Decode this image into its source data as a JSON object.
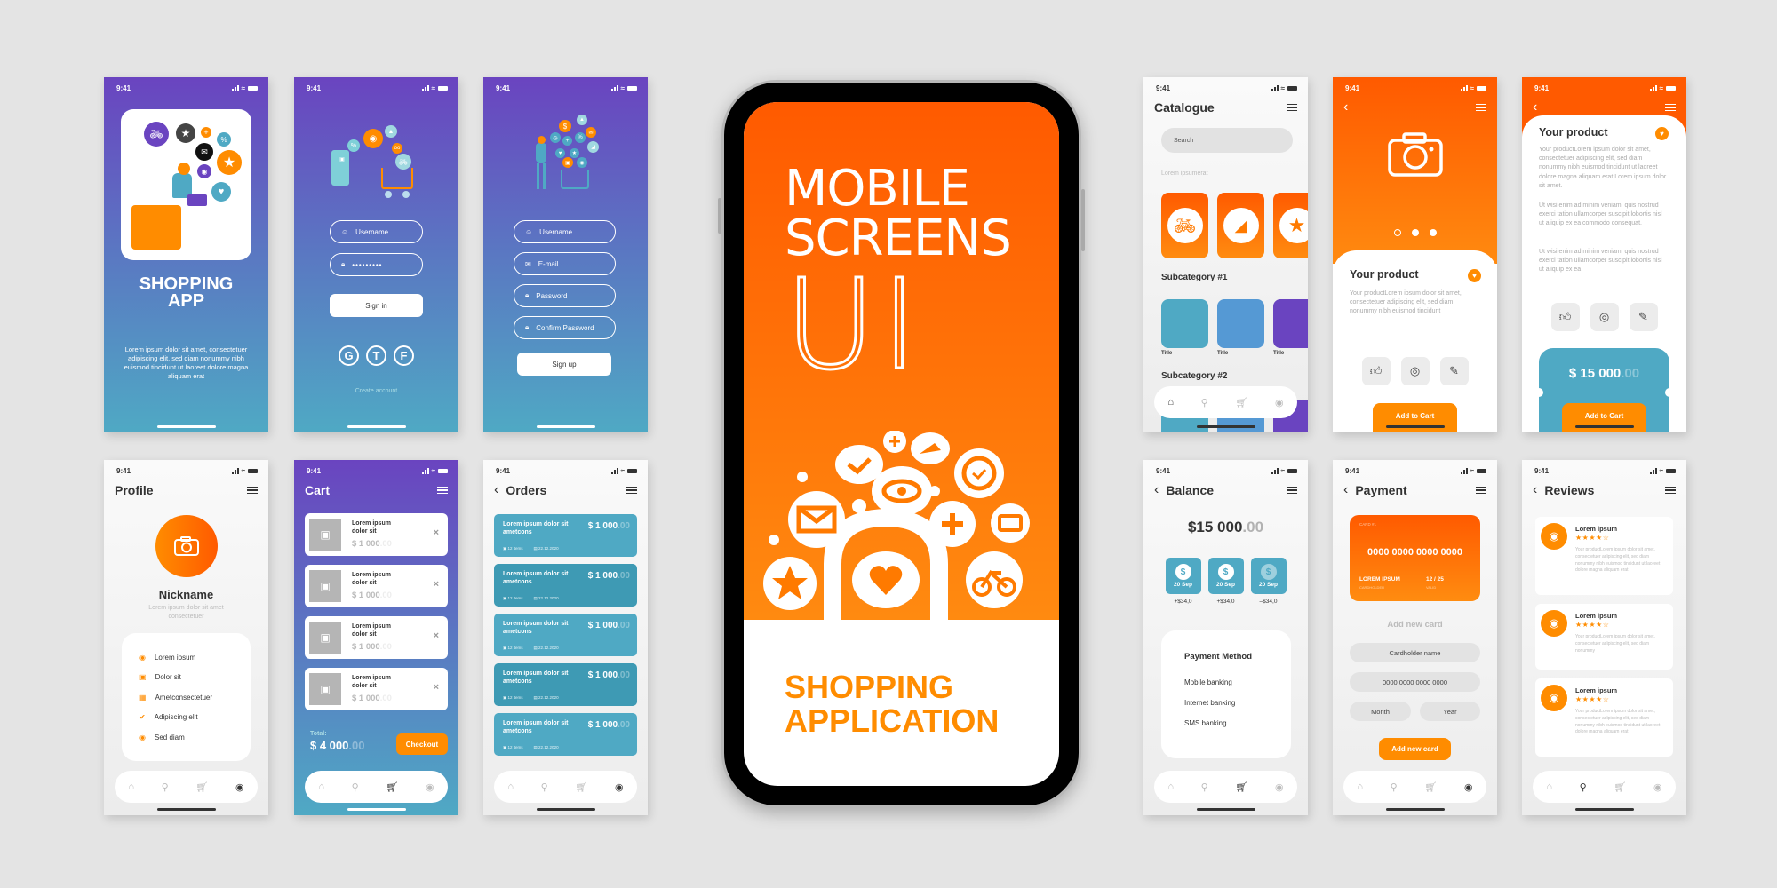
{
  "status_bar": {
    "time": "9:41"
  },
  "nav_icons": [
    "home-icon",
    "search-icon",
    "cart-icon",
    "profile-icon"
  ],
  "colors": {
    "orange": "#ff8c00",
    "deep_orange": "#ff5a00",
    "purple": "#6a44c0",
    "teal": "#4fa9c4",
    "dark_text": "#333333"
  },
  "splash": {
    "title_line1": "SHOPPING",
    "title_line2": "APP",
    "body": "Lorem ipsum dolor sit amet, consectetuer adipiscing elit, sed diam nonummy nibh euismod tincidunt ut laoreet dolore magna aliquam erat"
  },
  "signin": {
    "username_placeholder": "Username",
    "password_value": "•••••••••",
    "signin_label": "Sign in",
    "social": [
      "G",
      "T",
      "F"
    ],
    "create_account": "Create account"
  },
  "signup": {
    "fields": [
      "Username",
      "E-mail",
      "Password",
      "Confirm Password"
    ],
    "signup_label": "Sign up"
  },
  "hero": {
    "line1": "MOBILE",
    "line2": "SCREENS",
    "line3": "UI",
    "sub1": "SHOPPING",
    "sub2": "APPLICATION"
  },
  "catalogue": {
    "title": "Catalogue",
    "search_placeholder": "Search",
    "caption": "Lorem ipsumerat",
    "categories": [
      "bicycle-icon",
      "shoe-icon",
      "star-icon"
    ],
    "sub1_title": "Subcategory #1",
    "sub1_items": [
      {
        "title": "Title",
        "color": "#4fa9c4"
      },
      {
        "title": "Title",
        "color": "#5599d4"
      },
      {
        "title": "Title",
        "color": "#6a44c0"
      }
    ],
    "sub2_title": "Subcategory #2"
  },
  "product1": {
    "title": "Your product",
    "body": "Your productLorem ipsum dolor sit amet, consectetuer adipiscing elit, sed diam nonummy nibh euismod tincidunt",
    "carousel_active": 1,
    "carousel_count": 3,
    "add_to_cart": "Add to Cart"
  },
  "product2": {
    "title": "Your product",
    "para1": "Your productLorem ipsum dolor sit amet, consectetuer adipiscing elit, sed diam nonummy nibh euismod tincidunt ut laoreet dolore magna aliquam erat Lorem ipsum dolor sit amet.",
    "para2": "Ut wisi enim ad minim veniam, quis nostrud exerci tation ullamcorper suscipit lobortis nisl ut aliquip ex ea commodo consequat.",
    "para3": "Ut wisi enim ad minim veniam, quis nostrud exerci tation ullamcorper suscipit lobortis nisl ut aliquip ex ea",
    "price": "$ 15 000",
    "price_cents": ".00",
    "add_to_cart": "Add to Cart"
  },
  "profile": {
    "title": "Profile",
    "nickname": "Nickname",
    "subtitle": "Lorem ipsum dolor sit amet consectetuer",
    "menu": [
      {
        "label": "Lorem ipsum",
        "icon": "user-circle-icon"
      },
      {
        "label": "Dolor sit",
        "icon": "bookmark-icon"
      },
      {
        "label": "Ametconsectetuer",
        "icon": "gift-icon"
      },
      {
        "label": "Adipiscing elit",
        "icon": "shield-check-icon"
      },
      {
        "label": "Sed diam",
        "icon": "lock-circle-icon"
      }
    ]
  },
  "cart": {
    "title": "Cart",
    "items": [
      {
        "name": "Lorem ipsum dolor sit",
        "price": "$ 1 000",
        "cents": ".00"
      },
      {
        "name": "Lorem ipsum dolor sit",
        "price": "$ 1 000",
        "cents": ".00"
      },
      {
        "name": "Lorem ipsum dolor sit",
        "price": "$ 1 000",
        "cents": ".00"
      },
      {
        "name": "Lorem ipsum dolor sit",
        "price": "$ 1 000",
        "cents": ".00"
      }
    ],
    "total_label": "Total:",
    "total": "$ 4 000",
    "total_cents": ".00",
    "checkout": "Checkout"
  },
  "orders": {
    "title": "Orders",
    "items": [
      {
        "name": "Lorem ipsum dolor sit ametcons",
        "price": "$ 1 000",
        "cents": ".00",
        "count": "12 items",
        "date": "22.12.2020"
      },
      {
        "name": "Lorem ipsum dolor sit ametcons",
        "price": "$ 1 000",
        "cents": ".00",
        "count": "12 items",
        "date": "22.12.2020"
      },
      {
        "name": "Lorem ipsum dolor sit ametcons",
        "price": "$ 1 000",
        "cents": ".00",
        "count": "12 items",
        "date": "22.12.2020"
      },
      {
        "name": "Lorem ipsum dolor sit ametcons",
        "price": "$ 1 000",
        "cents": ".00",
        "count": "12 items",
        "date": "22.12.2020"
      },
      {
        "name": "Lorem ipsum dolor sit ametcons",
        "price": "$ 1 000",
        "cents": ".00",
        "count": "12 items",
        "date": "22.12.2020"
      }
    ]
  },
  "balance": {
    "title": "Balance",
    "amount": "$15 000",
    "cents": ".00",
    "transactions": [
      {
        "date": "20 Sep",
        "amount": "+$34,0"
      },
      {
        "date": "20 Sep",
        "amount": "+$34,0"
      },
      {
        "date": "20 Sep",
        "amount": "–$34,0"
      }
    ],
    "method_title": "Payment Method",
    "methods": [
      "Mobile banking",
      "Internet banking",
      "SMS banking"
    ]
  },
  "payment": {
    "title": "Payment",
    "card_label": "CARD #1",
    "card_number": "0000 0000 0000 0000",
    "holder": "LOREM IPSUM",
    "holder_label": "CARDHOLDER",
    "valid": "12 / 25",
    "valid_label": "VALID",
    "add_title": "Add new card",
    "name_placeholder": "Cardholder name",
    "number_placeholder": "0000 0000 0000 0000",
    "month_placeholder": "Month",
    "year_placeholder": "Year",
    "add_button": "Add new card"
  },
  "reviews": {
    "title": "Reviews",
    "items": [
      {
        "name": "Lorem ipsum",
        "rating": 4,
        "text": "Your productLorem ipsum dolor sit amet, consectetuer adipiscing elit, sed diam nonummy nibh euismod tincidunt ut laoreet dolore magna aliquam erat"
      },
      {
        "name": "Lorem ipsum",
        "rating": 4,
        "text": "Your productLorem ipsum dolor sit amet, consectetuer adipiscing elit, sed diam nonummy"
      },
      {
        "name": "Lorem ipsum",
        "rating": 4,
        "text": "Your productLorem ipsum dolor sit amet, consectetuer adipiscing elit, sed diam nonummy nibh euismod tincidunt ut laoreet dolore magna aliquam erat"
      }
    ]
  }
}
